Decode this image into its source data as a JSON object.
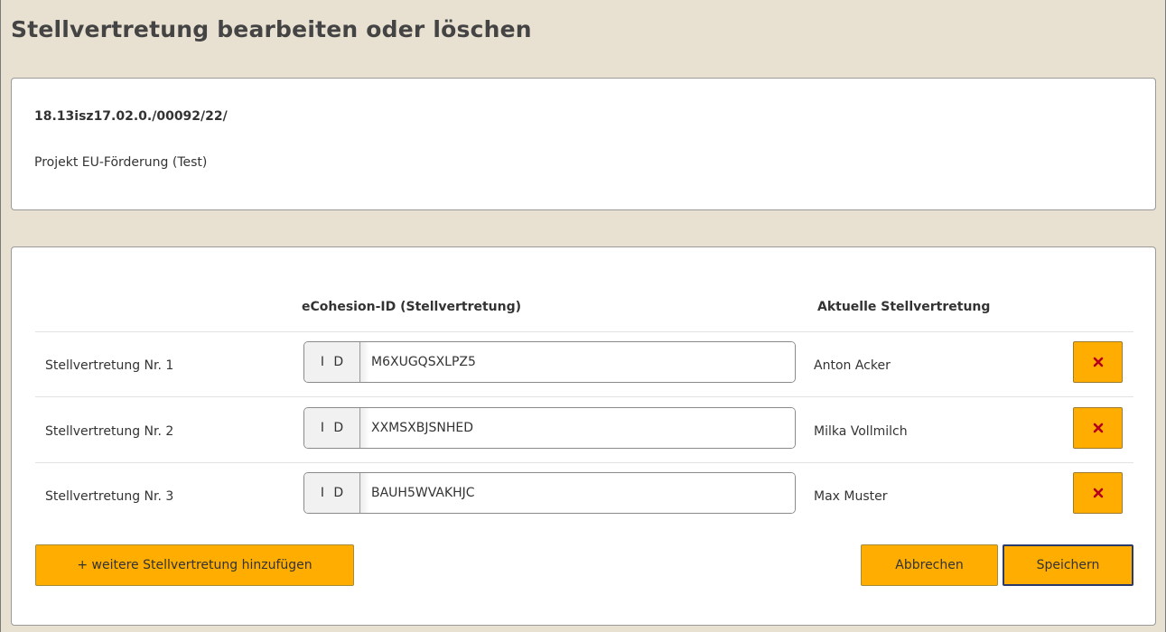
{
  "page": {
    "title": "Stellvertretung bearbeiten oder löschen"
  },
  "info": {
    "reference": "18.13isz17.02.0./00092/22/",
    "project": "Projekt EU-Förderung (Test)"
  },
  "table": {
    "headers": {
      "id": "eCohesion-ID (Stellvertretung)",
      "current": "Aktuelle Stellvertretung"
    },
    "rows": [
      {
        "label": "Stellvertretung Nr. 1",
        "prefix": "I D",
        "id_value": "M6XUGQSXLPZ5",
        "current": "Anton Acker",
        "delete_icon": "close-icon"
      },
      {
        "label": "Stellvertretung Nr. 2",
        "prefix": "I D",
        "id_value": "XXMSXBJSNHED",
        "current": "Milka Vollmilch",
        "delete_icon": "close-icon"
      },
      {
        "label": "Stellvertretung Nr. 3",
        "prefix": "I D",
        "id_value": "BAUH5WVAKHJC",
        "current": "Max Muster",
        "delete_icon": "close-icon"
      }
    ]
  },
  "actions": {
    "add_label": "+ weitere Stellvertretung hinzufügen",
    "cancel_label": "Abbrechen",
    "save_label": "Speichern"
  },
  "colors": {
    "background": "#e8e0d0",
    "accent": "#ffad00",
    "delete_icon": "#b3001b",
    "save_border": "#2a3a6a"
  }
}
